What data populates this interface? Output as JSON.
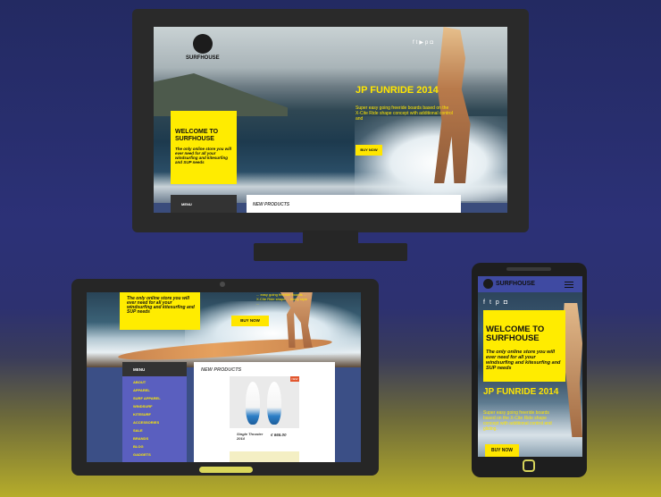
{
  "site": {
    "brand": "SURFHOUSE",
    "accent_color": "#ffec00",
    "nav_color": "#3f4aa2"
  },
  "desktop": {
    "logo_text": "SURFHOUSE",
    "welcome_title": "WELCOME TO SURFHOUSE",
    "welcome_text": "The only online store you will ever need for all your windsurfing and kitesurfing and SUP needs",
    "promo_title": "JP FUNRIDE 2014",
    "promo_text": "Super easy going freeride boards based on the X-Cite Ride shape concept with additional control and",
    "buy_label": "BUY NOW",
    "menu_label": "MENU",
    "products_title": "NEW PRODUCTS",
    "social_icons": [
      "facebook-icon",
      "twitter-icon",
      "youtube-icon",
      "pinterest-icon",
      "instagram-icon"
    ]
  },
  "tablet": {
    "welcome_text": "The only online store you will ever need for all your windsurfing and kitesurfing and SUP needs",
    "promo_text": "... easy going freeride boards ... X-Cite Ride shape ... every style ...",
    "buy_label": "BUY NOW",
    "menu_label": "MENU",
    "menu_items": [
      "ABOUT",
      "APPAREL",
      "SURF APPAREL",
      "WINDSURF",
      "KITESURF",
      "ACCESSORIES",
      "SALE",
      "BRANDS",
      "BLOG",
      "GADGETS"
    ],
    "products_title": "NEW PRODUCTS",
    "product": {
      "badge": "NEW",
      "name": "Single Thruster 2014",
      "price": "€ 665.00"
    }
  },
  "phone": {
    "logo_text": "SURFHOUSE",
    "welcome_title": "WELCOME TO SURFHOUSE",
    "welcome_text": "The only online store you will ever need for all your windsurfing and kitesurfing and SUP needs",
    "promo_title": "JP FUNRIDE 2014",
    "promo_text": "Super easy going freeride boards based on the X-Cite Ride shape concept with additional control and gliding.",
    "buy_label": "BUY NOW",
    "social_icons": [
      "facebook-icon",
      "twitter-icon",
      "pinterest-icon",
      "instagram-icon"
    ]
  }
}
